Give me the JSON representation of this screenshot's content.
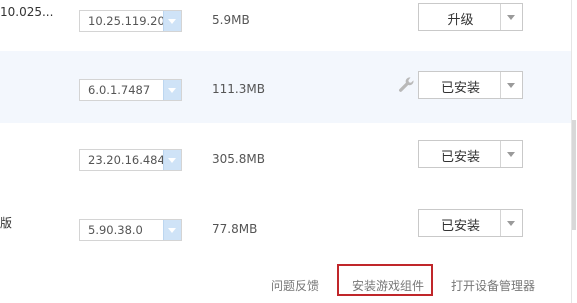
{
  "rows": [
    {
      "name": "10.025...",
      "version": "10.25.119.20",
      "size": "5.9MB",
      "action": "升级"
    },
    {
      "name": "",
      "version": "6.0.1.7487",
      "size": "111.3MB",
      "action": "已安装"
    },
    {
      "name": "",
      "version": "23.20.16.484",
      "size": "305.8MB",
      "action": "已安装"
    },
    {
      "name": "版",
      "version": "5.90.38.0",
      "size": "77.8MB",
      "action": "已安装"
    }
  ],
  "footer": {
    "feedback": "问题反馈",
    "install_components": "安装游戏组件",
    "device_manager": "打开设备管理器"
  },
  "icons": {
    "wrench": "wrench-icon",
    "dropdown": "chevron-down-icon"
  },
  "colors": {
    "highlight_box": "#c0262a",
    "selected_row": "#f3f7fd",
    "version_dropdown": "#cfe3f7"
  }
}
